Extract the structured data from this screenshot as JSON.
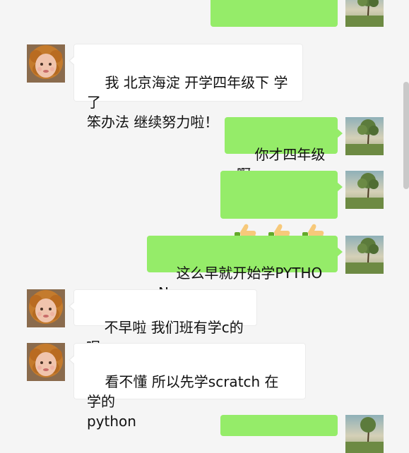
{
  "chat": {
    "messages": [
      {
        "side": "out",
        "text": ""
      },
      {
        "side": "in",
        "text": "我 北京海淀 开学四年级下 学了\n笨办法 继续努力啦！"
      },
      {
        "side": "out",
        "text": "你才四年级啊"
      },
      {
        "side": "out",
        "emoji": [
          "thumbs-up",
          "thumbs-up",
          "thumbs-up"
        ]
      },
      {
        "side": "out",
        "text": "这么早就开始学PYTHON"
      },
      {
        "side": "in",
        "text": "不早啦 我们班有学c的呢"
      },
      {
        "side": "in",
        "text": "看不懂 所以先学scratch 在学的\npython"
      },
      {
        "side": "out",
        "text": ""
      }
    ]
  },
  "colors": {
    "background": "#f5f5f5",
    "incoming_bubble": "#ffffff",
    "outgoing_bubble": "#95ec69"
  },
  "icons": {
    "incoming_avatar": "cherub-portrait-avatar",
    "outgoing_avatar": "tree-landscape-avatar",
    "emoji": "thumbs-up-icon"
  }
}
